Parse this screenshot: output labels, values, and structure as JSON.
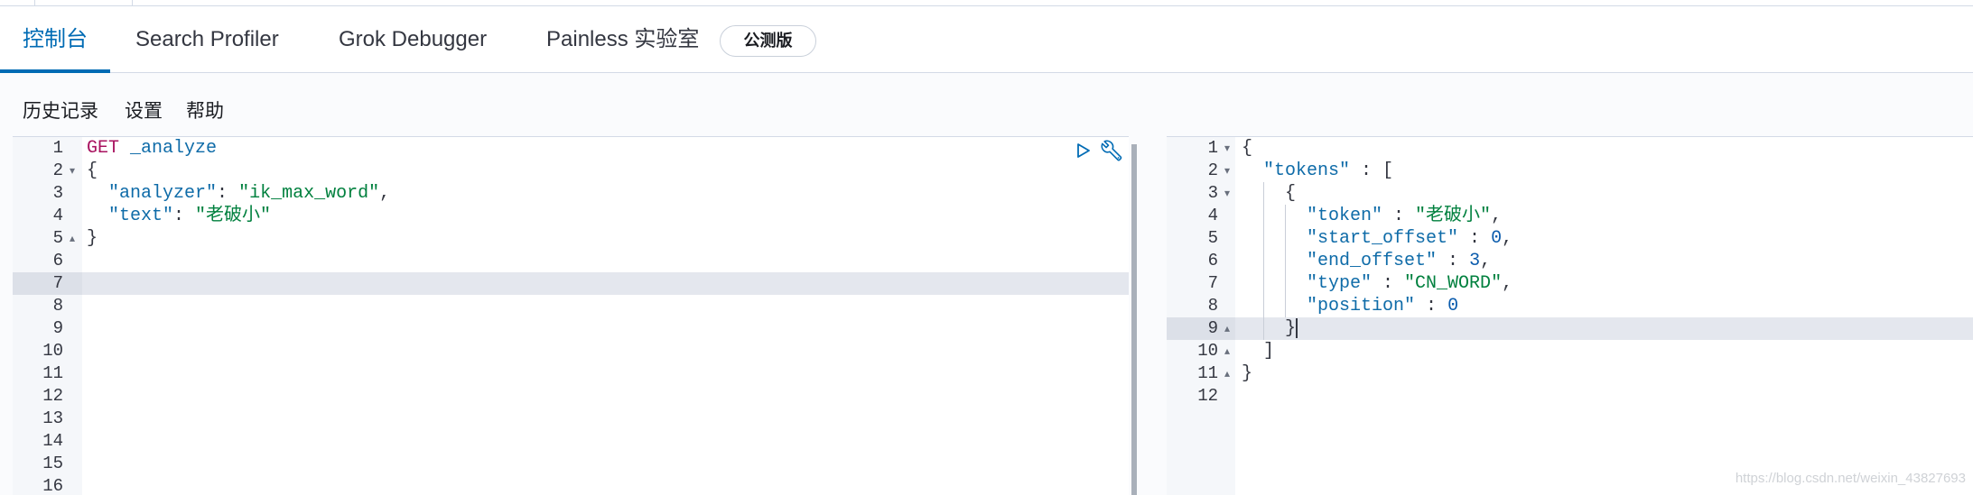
{
  "tabs": [
    {
      "label": "控制台",
      "active": true
    },
    {
      "label": "Search Profiler",
      "active": false
    },
    {
      "label": "Grok Debugger",
      "active": false
    },
    {
      "label": "Painless 实验室",
      "active": false
    }
  ],
  "badge": "公测版",
  "toolbar": [
    {
      "label": "历史记录"
    },
    {
      "label": "设置"
    },
    {
      "label": "帮助"
    }
  ],
  "request_editor": {
    "actions": [
      {
        "icon": "play-icon"
      },
      {
        "icon": "wrench-icon"
      }
    ],
    "active_line": 7,
    "cursor_line": null,
    "lines": [
      {
        "n": 1,
        "fold": "",
        "tokens": [
          {
            "t": "GET",
            "c": "method"
          },
          {
            "t": " ",
            "c": "text"
          },
          {
            "t": "_analyze",
            "c": "url"
          }
        ]
      },
      {
        "n": 2,
        "fold": "down",
        "tokens": [
          {
            "t": "{",
            "c": "punct"
          }
        ]
      },
      {
        "n": 3,
        "fold": "",
        "tokens": [
          {
            "t": "  ",
            "c": "text"
          },
          {
            "t": "\"analyzer\"",
            "c": "key"
          },
          {
            "t": ": ",
            "c": "punct"
          },
          {
            "t": "\"ik_max_word\"",
            "c": "string"
          },
          {
            "t": ",",
            "c": "punct"
          }
        ]
      },
      {
        "n": 4,
        "fold": "",
        "tokens": [
          {
            "t": "  ",
            "c": "text"
          },
          {
            "t": "\"text\"",
            "c": "key"
          },
          {
            "t": ": ",
            "c": "punct"
          },
          {
            "t": "\"老破小\"",
            "c": "string"
          }
        ]
      },
      {
        "n": 5,
        "fold": "up",
        "tokens": [
          {
            "t": "}",
            "c": "punct"
          }
        ]
      },
      {
        "n": 6,
        "fold": "",
        "tokens": []
      },
      {
        "n": 7,
        "fold": "",
        "tokens": []
      },
      {
        "n": 8,
        "fold": "",
        "tokens": []
      },
      {
        "n": 9,
        "fold": "",
        "tokens": []
      },
      {
        "n": 10,
        "fold": "",
        "tokens": []
      },
      {
        "n": 11,
        "fold": "",
        "tokens": []
      },
      {
        "n": 12,
        "fold": "",
        "tokens": []
      },
      {
        "n": 13,
        "fold": "",
        "tokens": []
      },
      {
        "n": 14,
        "fold": "",
        "tokens": []
      },
      {
        "n": 15,
        "fold": "",
        "tokens": []
      },
      {
        "n": 16,
        "fold": "",
        "tokens": []
      }
    ]
  },
  "response_viewer": {
    "active_line": 9,
    "cursor_line": 9,
    "lines": [
      {
        "n": 1,
        "fold": "down",
        "tokens": [
          {
            "t": "{",
            "c": "punct"
          }
        ]
      },
      {
        "n": 2,
        "fold": "down",
        "tokens": [
          {
            "t": "  ",
            "c": "text"
          },
          {
            "t": "\"tokens\"",
            "c": "key"
          },
          {
            "t": " : [",
            "c": "punct"
          }
        ]
      },
      {
        "n": 3,
        "fold": "down",
        "tokens": [
          {
            "t": "    ",
            "c": "text"
          },
          {
            "t": "{",
            "c": "punct"
          }
        ]
      },
      {
        "n": 4,
        "fold": "",
        "tokens": [
          {
            "t": "      ",
            "c": "text"
          },
          {
            "t": "\"token\"",
            "c": "key"
          },
          {
            "t": " : ",
            "c": "punct"
          },
          {
            "t": "\"老破小\"",
            "c": "string"
          },
          {
            "t": ",",
            "c": "punct"
          }
        ]
      },
      {
        "n": 5,
        "fold": "",
        "tokens": [
          {
            "t": "      ",
            "c": "text"
          },
          {
            "t": "\"start_offset\"",
            "c": "key"
          },
          {
            "t": " : ",
            "c": "punct"
          },
          {
            "t": "0",
            "c": "number"
          },
          {
            "t": ",",
            "c": "punct"
          }
        ]
      },
      {
        "n": 6,
        "fold": "",
        "tokens": [
          {
            "t": "      ",
            "c": "text"
          },
          {
            "t": "\"end_offset\"",
            "c": "key"
          },
          {
            "t": " : ",
            "c": "punct"
          },
          {
            "t": "3",
            "c": "number"
          },
          {
            "t": ",",
            "c": "punct"
          }
        ]
      },
      {
        "n": 7,
        "fold": "",
        "tokens": [
          {
            "t": "      ",
            "c": "text"
          },
          {
            "t": "\"type\"",
            "c": "key"
          },
          {
            "t": " : ",
            "c": "punct"
          },
          {
            "t": "\"CN_WORD\"",
            "c": "string"
          },
          {
            "t": ",",
            "c": "punct"
          }
        ]
      },
      {
        "n": 8,
        "fold": "",
        "tokens": [
          {
            "t": "      ",
            "c": "text"
          },
          {
            "t": "\"position\"",
            "c": "key"
          },
          {
            "t": " : ",
            "c": "punct"
          },
          {
            "t": "0",
            "c": "number"
          }
        ]
      },
      {
        "n": 9,
        "fold": "up",
        "tokens": [
          {
            "t": "    ",
            "c": "text"
          },
          {
            "t": "}",
            "c": "punct"
          }
        ]
      },
      {
        "n": 10,
        "fold": "up",
        "tokens": [
          {
            "t": "  ",
            "c": "text"
          },
          {
            "t": "]",
            "c": "punct"
          }
        ]
      },
      {
        "n": 11,
        "fold": "up",
        "tokens": [
          {
            "t": "}",
            "c": "punct"
          }
        ]
      },
      {
        "n": 12,
        "fold": "",
        "tokens": []
      }
    ]
  },
  "watermark": "https://blog.csdn.net/weixin_43827693",
  "colors": {
    "accent": "#006bb4",
    "method": "#a8125f",
    "url": "#0e6ba8",
    "key": "#0e6ba8",
    "string": "#00803e",
    "number": "#0b5cad",
    "punct": "#343741",
    "active_line": "#e4e7ee",
    "active_gutter": "#dce0e8",
    "gutter": "#f5f7fa",
    "watermark": "#cfd2d6"
  }
}
